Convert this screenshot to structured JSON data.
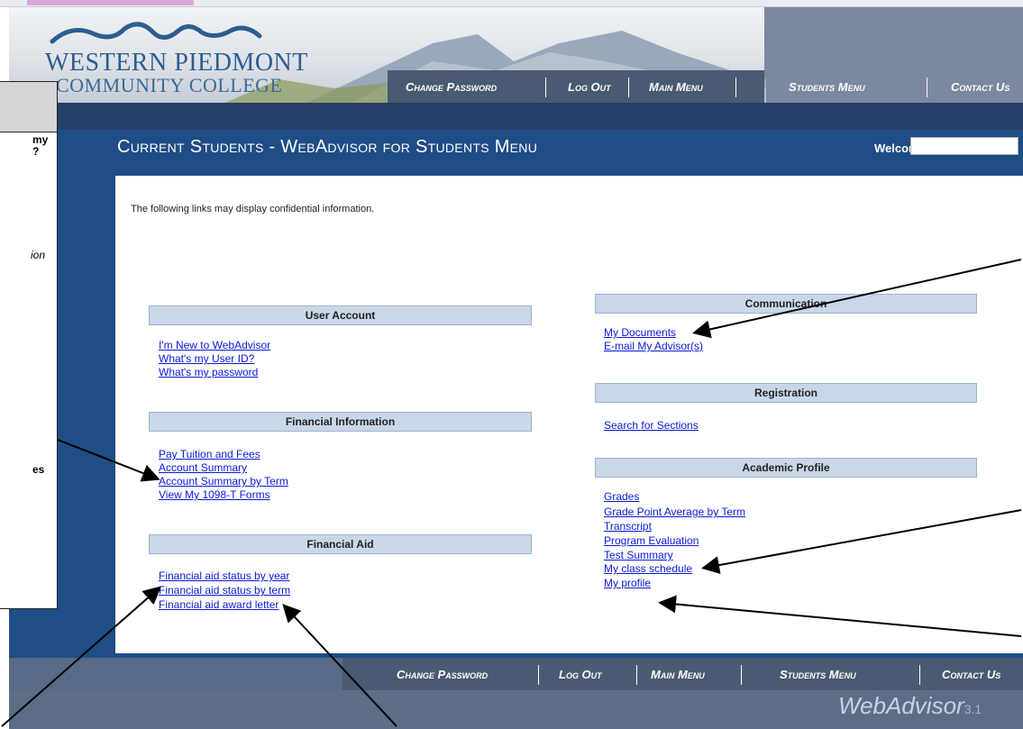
{
  "header": {
    "logo_line1": "WESTERN PIEDMONT",
    "logo_line2": "COMMUNITY COLLEGE",
    "nav": [
      "Change Password",
      "Log Out",
      "Main Menu",
      "Students Menu",
      "Contact Us"
    ]
  },
  "page": {
    "title": "Current Students - WebAdvisor for Students Menu",
    "welcome_label": "Welcome",
    "notice": "The following links may display confidential information."
  },
  "sections": {
    "user_account": {
      "title": "User Account",
      "links": [
        "I'm New to WebAdvisor",
        "What's my User ID?",
        "What's my password"
      ]
    },
    "financial_information": {
      "title": "Financial Information",
      "links": [
        "Pay Tuition and Fees",
        "Account Summary",
        "Account Summary by Term",
        "View My 1098-T Forms"
      ]
    },
    "financial_aid": {
      "title": "Financial Aid",
      "links": [
        "Financial aid status by year",
        "Financial aid status by term",
        "Financial aid award letter"
      ]
    },
    "communication": {
      "title": "Communication",
      "links": [
        "My Documents",
        "E-mail My Advisor(s)"
      ]
    },
    "registration": {
      "title": "Registration",
      "links": [
        "Search for Sections"
      ]
    },
    "academic_profile": {
      "title": "Academic Profile",
      "links": [
        "Grades",
        "Grade Point Average by Term",
        "Transcript",
        "Program Evaluation",
        "Test Summary",
        "My class schedule",
        "My profile"
      ]
    }
  },
  "footer": {
    "nav": [
      "Change Password",
      "Log Out",
      "Main Menu",
      "Students Menu",
      "Contact Us"
    ],
    "brand": "WebAdvisor",
    "version": "3.1"
  },
  "callout": {
    "fragments": [
      "my",
      "?",
      "ion",
      "es"
    ]
  },
  "colors": {
    "band": "#1f4d86",
    "section_header": "#c9d7e8",
    "link": "#0a1ad8",
    "nav_bar": "#4a5a72"
  }
}
